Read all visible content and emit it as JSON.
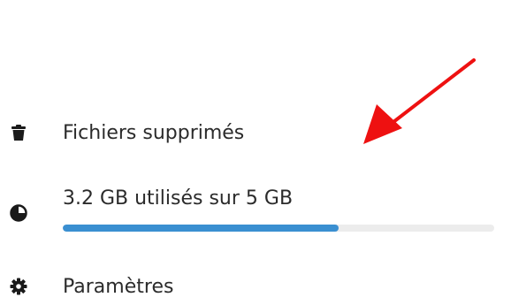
{
  "navigation": {
    "trash": {
      "label": "Fichiers supprimés",
      "icon": "trash-icon"
    },
    "quota": {
      "label": "3.2 GB utilisés sur 5 GB",
      "icon": "pie-chart-icon",
      "used_gb": 3.2,
      "total_gb": 5,
      "fill_color": "#3a8fd1",
      "track_color": "#ececec"
    },
    "settings": {
      "label": "Paramètres",
      "icon": "gear-icon"
    }
  },
  "annotation": {
    "icon": "red-arrow-icon",
    "color": "#ee1111"
  }
}
